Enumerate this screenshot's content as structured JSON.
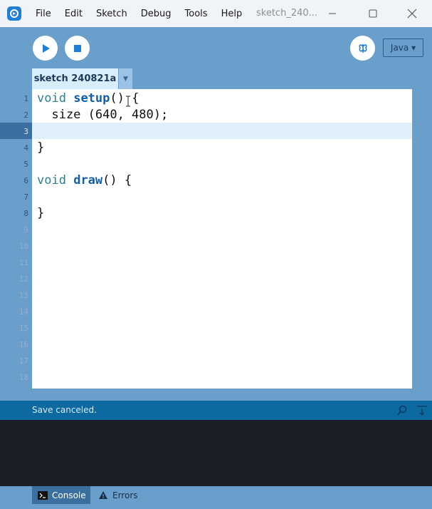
{
  "titlebar": {
    "menus": [
      "File",
      "Edit",
      "Sketch",
      "Debug",
      "Tools",
      "Help"
    ],
    "window_title": "sketch_240..."
  },
  "toolbar": {
    "mode": "Java ▾"
  },
  "tabs": [
    {
      "label": "sketch 240821a"
    }
  ],
  "editor": {
    "line_numbers": [
      "1",
      "2",
      "3",
      "4",
      "5",
      "6",
      "7",
      "8",
      "9",
      "10",
      "11",
      "12",
      "13",
      "14",
      "15",
      "16",
      "17",
      "18"
    ],
    "current_line": 3,
    "code": [
      {
        "kw": "void",
        "fn": "setup",
        "rest": "() {"
      },
      {
        "plain": "  size (640, 480);"
      },
      {
        "plain": ""
      },
      {
        "plain": "}"
      },
      {
        "plain": ""
      },
      {
        "kw": "void",
        "fn": "draw",
        "rest": "() {"
      },
      {
        "plain": ""
      },
      {
        "plain": "}"
      }
    ]
  },
  "status": {
    "message": "Save canceled."
  },
  "footer": {
    "console_label": "Console",
    "errors_label": "Errors"
  },
  "colors": {
    "accent": "#1f7fd6",
    "background": "#6a9ecb",
    "status_bar": "#0d6aa0",
    "console": "#1b1f27"
  }
}
